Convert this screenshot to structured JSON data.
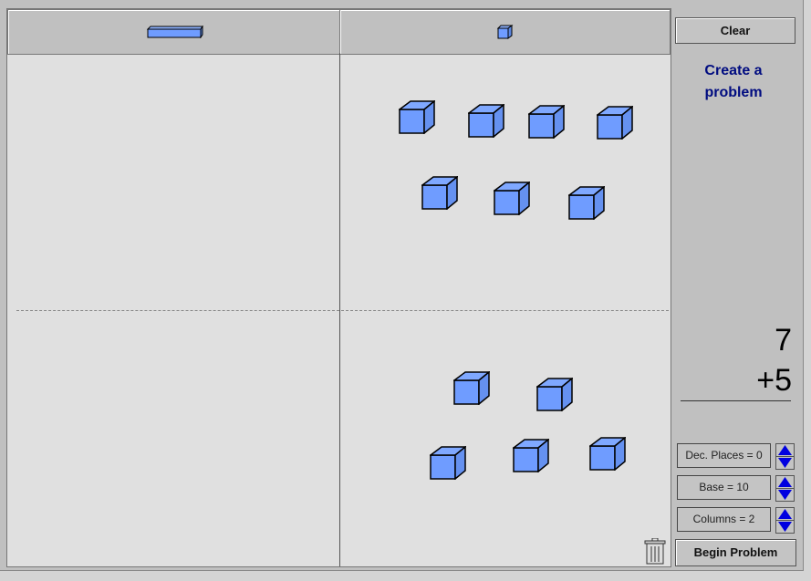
{
  "header": {
    "columns": [
      {
        "icon": "ten-rod-icon"
      },
      {
        "icon": "unit-cube-icon"
      }
    ]
  },
  "workspace": {
    "top_ones_cubes": 7,
    "bottom_ones_cubes": 5
  },
  "panel": {
    "clear_label": "Clear",
    "title": "Create a problem",
    "problem": {
      "top": "7",
      "bottom": "+5"
    },
    "settings": [
      {
        "label": "Dec. Places = 0"
      },
      {
        "label": "Base = 10"
      },
      {
        "label": "Columns = 2"
      }
    ],
    "begin_label": "Begin Problem"
  },
  "colors": {
    "cube": "#6f9cff",
    "title": "#000c80"
  }
}
